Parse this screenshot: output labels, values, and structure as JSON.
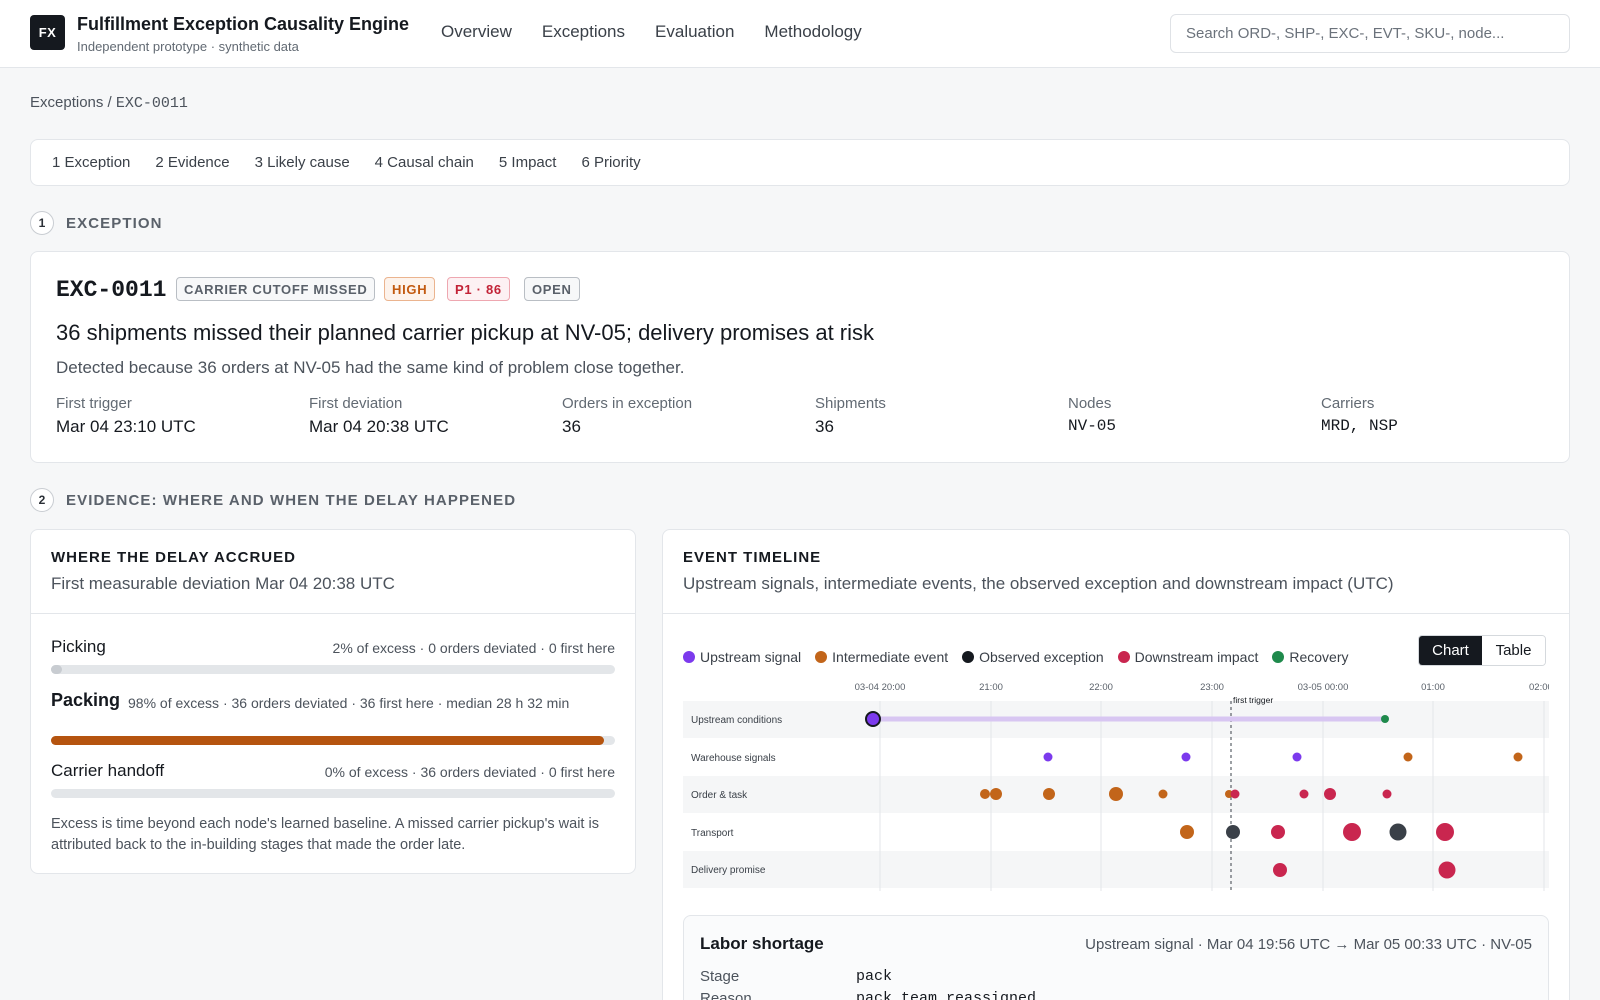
{
  "header": {
    "logo": "FX",
    "title": "Fulfillment Exception Causality Engine",
    "subtitle": "Independent prototype · synthetic data",
    "nav": [
      "Overview",
      "Exceptions",
      "Evaluation",
      "Methodology"
    ],
    "search_placeholder": "Search ORD-, SHP-, EXC-, EVT-, SKU-, node..."
  },
  "breadcrumb": {
    "parent": "Exceptions",
    "sep": " / ",
    "current": "EXC-0011"
  },
  "steps": [
    "1 Exception",
    "2 Evidence",
    "3 Likely cause",
    "4 Causal chain",
    "5 Impact",
    "6 Priority"
  ],
  "section1": {
    "num": "1",
    "title": "EXCEPTION"
  },
  "exception": {
    "id": "EXC-0011",
    "badges": {
      "type": "CARRIER CUTOFF MISSED",
      "severity": "HIGH",
      "priority": "P1 · 86",
      "status": "OPEN"
    },
    "headline": "36 shipments missed their planned carrier pickup at NV-05; delivery promises at risk",
    "detected": "Detected because 36 orders at NV-05 had the same kind of problem close together.",
    "meta": [
      {
        "label": "First trigger",
        "value": "Mar 04 23:10 UTC"
      },
      {
        "label": "First deviation",
        "value": "Mar 04 20:38 UTC"
      },
      {
        "label": "Orders in exception",
        "value": "36"
      },
      {
        "label": "Shipments",
        "value": "36"
      },
      {
        "label": "Nodes",
        "value": "NV-05"
      },
      {
        "label": "Carriers",
        "value": "MRD, NSP"
      }
    ]
  },
  "section2": {
    "num": "2",
    "title": "EVIDENCE: WHERE AND WHEN THE DELAY HAPPENED"
  },
  "delay": {
    "title": "WHERE THE DELAY ACCRUED",
    "subtitle": "First measurable deviation Mar 04 20:38 UTC",
    "stages": [
      {
        "name": "Picking",
        "stats": "2% of excess · 0 orders deviated · 0 first here",
        "share": 0.02
      },
      {
        "name": "Packing",
        "stats": "98% of excess · 36 orders deviated · 36 first here · median 28 h 32 min",
        "share": 0.98
      },
      {
        "name": "Carrier handoff",
        "stats": "0% of excess · 36 orders deviated · 0 first here",
        "share": 0.0
      }
    ],
    "note": "Excess is time beyond each node's learned baseline. A missed carrier pickup's wait is attributed back to the in-building stages that made the order late."
  },
  "timeline": {
    "title": "EVENT TIMELINE",
    "subtitle": "Upstream signals, intermediate events, the observed exception and downstream impact (UTC)",
    "legend": [
      {
        "label": "Upstream signal",
        "color": "#7c3aed"
      },
      {
        "label": "Intermediate event",
        "color": "#c2651a"
      },
      {
        "label": "Observed exception",
        "color": "#15191f"
      },
      {
        "label": "Downstream impact",
        "color": "#c9264f"
      },
      {
        "label": "Recovery",
        "color": "#1f8a4c"
      }
    ],
    "toggle": {
      "chart": "Chart",
      "table": "Table"
    },
    "ticks": [
      "03-04 20:00",
      "21:00",
      "22:00",
      "23:00",
      "03-05 00:00",
      "01:00",
      "02:00"
    ],
    "trigger_label": "first trigger",
    "lanes": [
      "Upstream conditions",
      "Warehouse signals",
      "Order & task",
      "Transport",
      "Delivery promise"
    ]
  },
  "detail": {
    "title": "Labor shortage",
    "meta": "Upstream signal · Mar 04 19:56 UTC → Mar 05 00:33 UTC · NV-05",
    "rows": [
      {
        "label": "Stage",
        "value": "pack"
      },
      {
        "label": "Reason",
        "value": "pack_team_reassigned"
      }
    ]
  }
}
